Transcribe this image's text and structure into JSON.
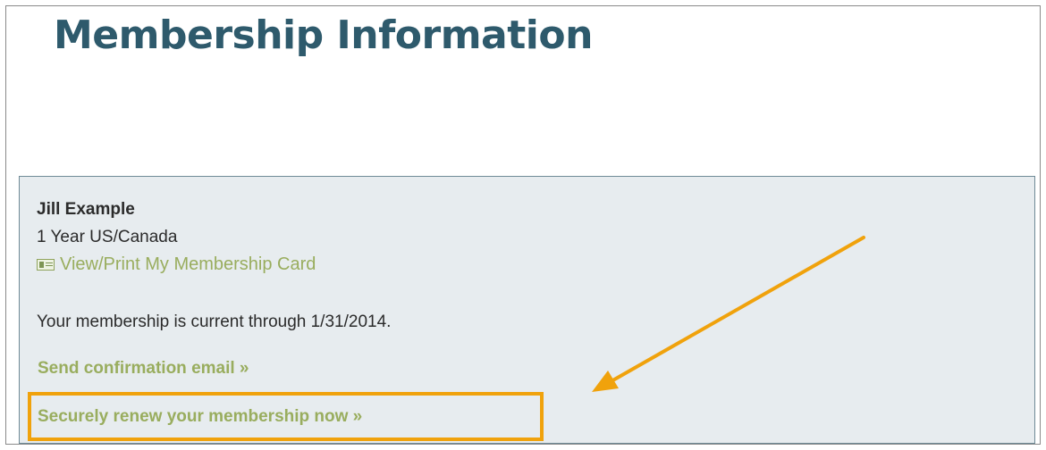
{
  "page": {
    "title": "Membership Information"
  },
  "member": {
    "name": "Jill Example",
    "plan": "1 Year US/Canada",
    "card_link": "View/Print My Membership Card",
    "card_icon": "membership-card-icon",
    "status_text": "Your membership is current through 1/31/2014."
  },
  "actions": {
    "send_confirmation": "Send confirmation email »",
    "renew": "Securely renew your membership now »"
  },
  "colors": {
    "title": "#2e5a6c",
    "panel_bg": "#e7ecef",
    "link": "#99ad5e",
    "highlight": "#f0a20c"
  }
}
